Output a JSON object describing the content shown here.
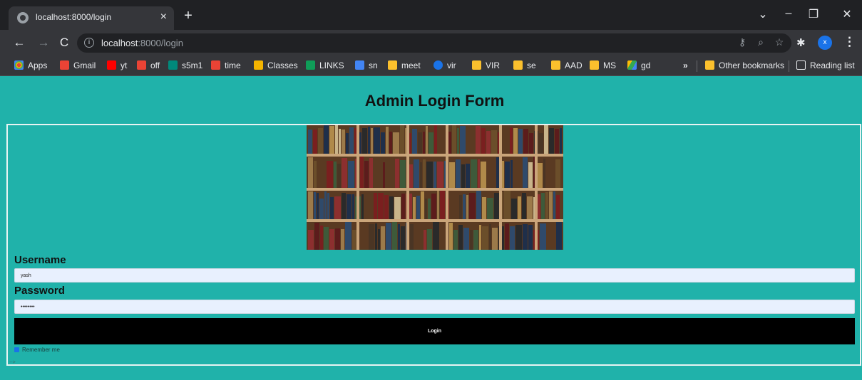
{
  "browser": {
    "tab_title": "localhost:8000/login",
    "tab_close": "×",
    "new_tab": "+",
    "url_host": "localhost",
    "url_path": ":8000/login",
    "profile_initial": "x",
    "bookmarks": [
      {
        "label": "Apps",
        "icon_color": "#ea4335"
      },
      {
        "label": "Gmail",
        "icon_color": "#ea4335"
      },
      {
        "label": "yt",
        "icon_color": "#ff0000"
      },
      {
        "label": "off",
        "icon_color": "#ea4335"
      },
      {
        "label": "s5m1",
        "icon_color": "#00897b"
      },
      {
        "label": "time",
        "icon_color": "#ea4335"
      },
      {
        "label": "Classes",
        "icon_color": "#f4b400"
      },
      {
        "label": "LINKS",
        "icon_color": "#0f9d58"
      },
      {
        "label": "sn",
        "icon_color": "#4285f4"
      },
      {
        "label": "meet",
        "icon_color": "#fbc02d"
      },
      {
        "label": "vir",
        "icon_color": "#1a73e8"
      },
      {
        "label": "VIR",
        "icon_color": "#fbc02d"
      },
      {
        "label": "se",
        "icon_color": "#fbc02d"
      },
      {
        "label": "AAD",
        "icon_color": "#fbc02d"
      },
      {
        "label": "MS",
        "icon_color": "#fbc02d"
      },
      {
        "label": "gd",
        "icon_color": "#34a853"
      }
    ],
    "overflow": "»",
    "other_bookmarks": "Other bookmarks",
    "reading_list": "Reading list"
  },
  "page": {
    "title": "Admin Login Form",
    "username_label": "Username",
    "username_value": "yash",
    "password_label": "Password",
    "password_value": "••••••••",
    "login_label": "Login",
    "remember_label": "Remember me",
    "remember_checked": true,
    "stray_text": "-->"
  },
  "colors": {
    "page_bg": "#20b2aa",
    "button_bg": "#000000",
    "input_bg": "#e8f0fe"
  }
}
